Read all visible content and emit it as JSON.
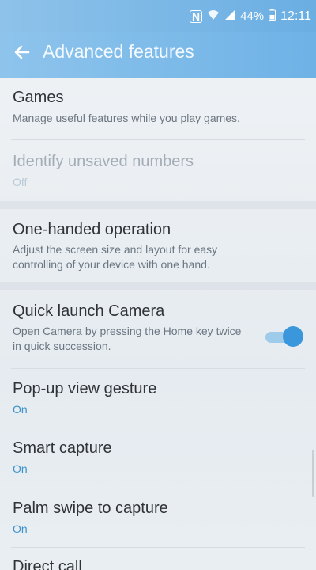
{
  "status": {
    "nfc": "N",
    "battery": "44%",
    "time": "12:11",
    "icons": [
      "nfc-icon",
      "wifi-icon",
      "signal-icon",
      "battery-icon"
    ]
  },
  "header": {
    "title": "Advanced features",
    "back_icon": "arrow-left-icon"
  },
  "items": [
    {
      "title": "Games",
      "subtitle": "Manage useful features while you play games."
    },
    {
      "title": "Identify unsaved numbers",
      "subtitle": "Off",
      "enabled": false
    },
    {
      "title": "One-handed operation",
      "subtitle": "Adjust the screen size and layout for easy controlling of your device with one hand."
    },
    {
      "title": "Quick launch Camera",
      "subtitle": "Open Camera by pressing the Home key twice in quick succession.",
      "toggle": true
    },
    {
      "title": "Pop-up view gesture",
      "subtitle": "On"
    },
    {
      "title": "Smart capture",
      "subtitle": "On"
    },
    {
      "title": "Palm swipe to capture",
      "subtitle": "On"
    },
    {
      "title": "Direct call"
    }
  ],
  "colors": {
    "accent": "#3b97dc",
    "appbar": "#7ab8e8"
  }
}
